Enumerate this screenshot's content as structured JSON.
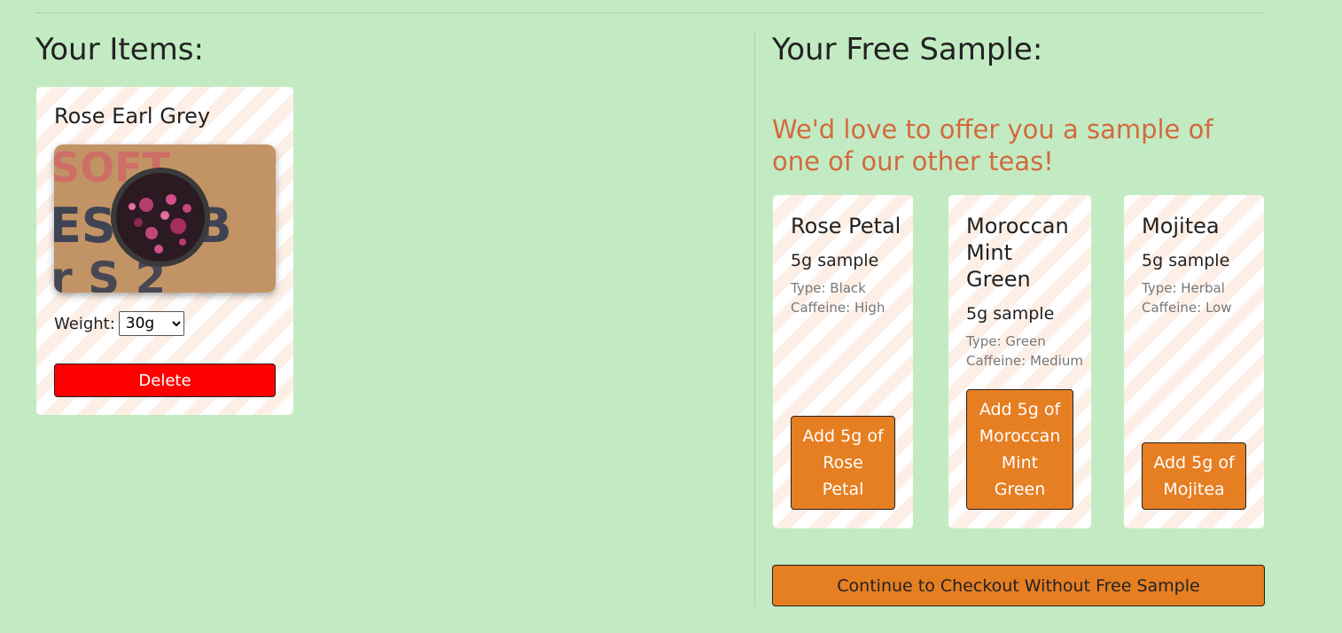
{
  "your_items": {
    "heading": "Your Items:",
    "item": {
      "name": "Rose Earl Grey",
      "photo_icon": "tea-scoop-photo",
      "weight_label": "Weight:",
      "weight_selected": "30g",
      "delete_label": "Delete"
    }
  },
  "free_sample": {
    "heading": "Your Free Sample:",
    "offer_text": "We'd love to offer you a sample of one of our other teas!",
    "samples": [
      {
        "name": "Rose Petal",
        "size": "5g sample",
        "type": "Type: Black",
        "caffeine": "Caffeine: High",
        "button": "Add 5g of Rose Petal"
      },
      {
        "name": "Moroccan Mint Green",
        "size": "5g sample",
        "type": "Type: Green",
        "caffeine": "Caffeine: Medium",
        "button": "Add 5g of Moroccan Mint Green"
      },
      {
        "name": "Mojitea",
        "size": "5g sample",
        "type": "Type: Herbal",
        "caffeine": "Caffeine: Low",
        "button": "Add 5g of Mojitea"
      }
    ],
    "checkout_label": "Continue to Checkout Without Free Sample"
  },
  "colors": {
    "background": "#c3ebc3",
    "accent_orange": "#e67e22",
    "offer_text": "#d26a3e",
    "delete_red": "#ff0000"
  }
}
